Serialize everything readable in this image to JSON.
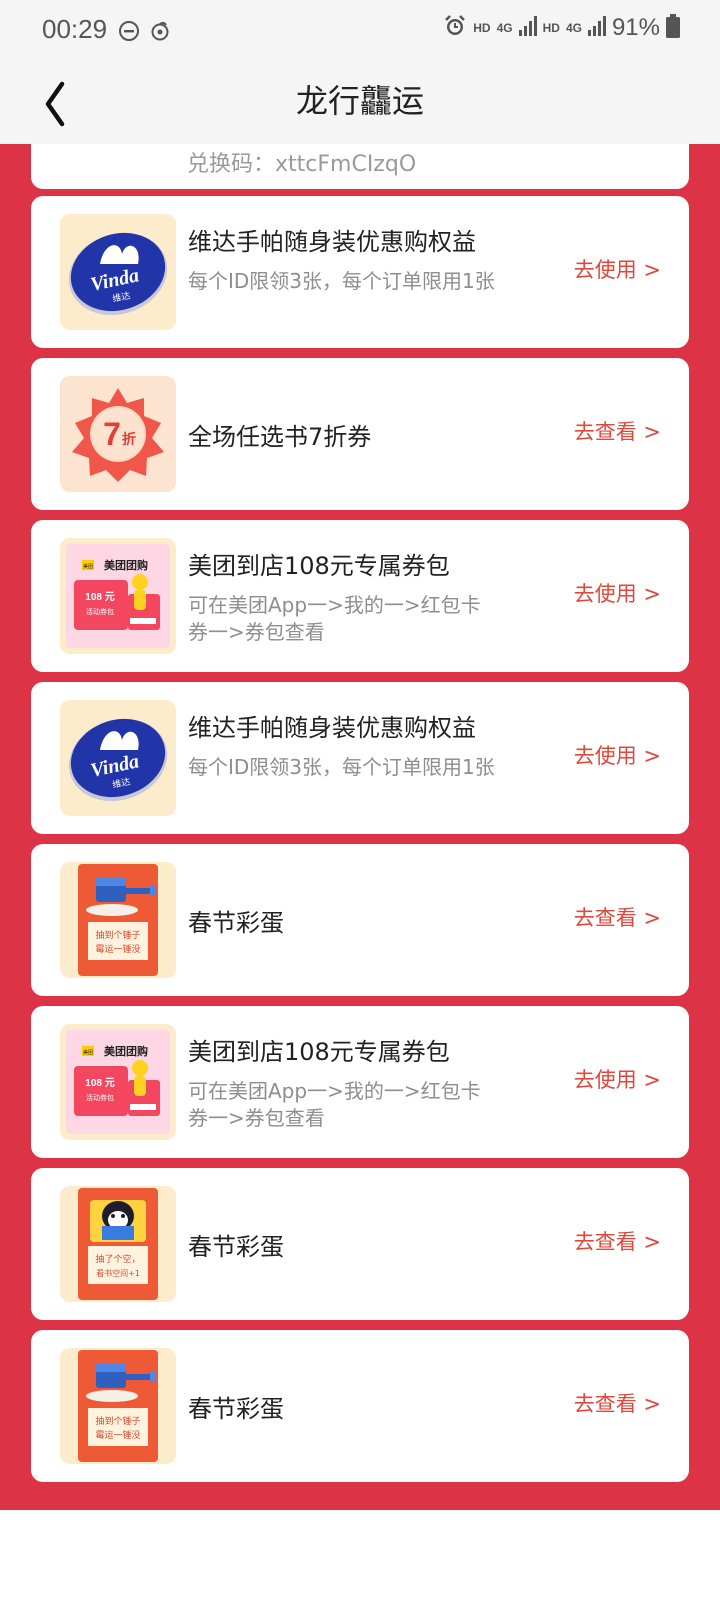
{
  "status_bar": {
    "time": "00:29",
    "hd1": "HD",
    "net1": "4G",
    "hd2": "HD",
    "net2": "4G",
    "battery": "91%"
  },
  "header": {
    "title": "龙行龘运"
  },
  "partial_card": {
    "text": "兑换码：xttcFmCIzqO"
  },
  "cards": [
    {
      "title": "维达手帕随身装优惠购权益",
      "desc": "每个ID限领3张，每个订单限用1张",
      "action": "去使用 >",
      "thumb": "Vinda 维达"
    },
    {
      "title": "全场任选书7折券",
      "desc": "",
      "action": "去查看 >",
      "thumb": "7折"
    },
    {
      "title": "美团到店108元专属券包",
      "desc": "可在美团App一>我的一>红包卡券一>券包查看",
      "action": "去使用 >",
      "thumb": "美团团购 108 元 活动券包"
    },
    {
      "title": "维达手帕随身装优惠购权益",
      "desc": "每个ID限领3张，每个订单限用1张",
      "action": "去使用 >",
      "thumb": "Vinda 维达"
    },
    {
      "title": "春节彩蛋",
      "desc": "",
      "action": "去查看 >",
      "thumb": "抽到个锤子 霉运一锤没"
    },
    {
      "title": "美团到店108元专属券包",
      "desc": "可在美团App一>我的一>红包卡券一>券包查看",
      "action": "去使用 >",
      "thumb": "美团团购 108 元 活动券包"
    },
    {
      "title": "春节彩蛋",
      "desc": "",
      "action": "去查看 >",
      "thumb": "抽了个空，看书空间+1"
    },
    {
      "title": "春节彩蛋",
      "desc": "",
      "action": "去查看 >",
      "thumb": "抽到个锤子 霉运一锤没"
    }
  ]
}
